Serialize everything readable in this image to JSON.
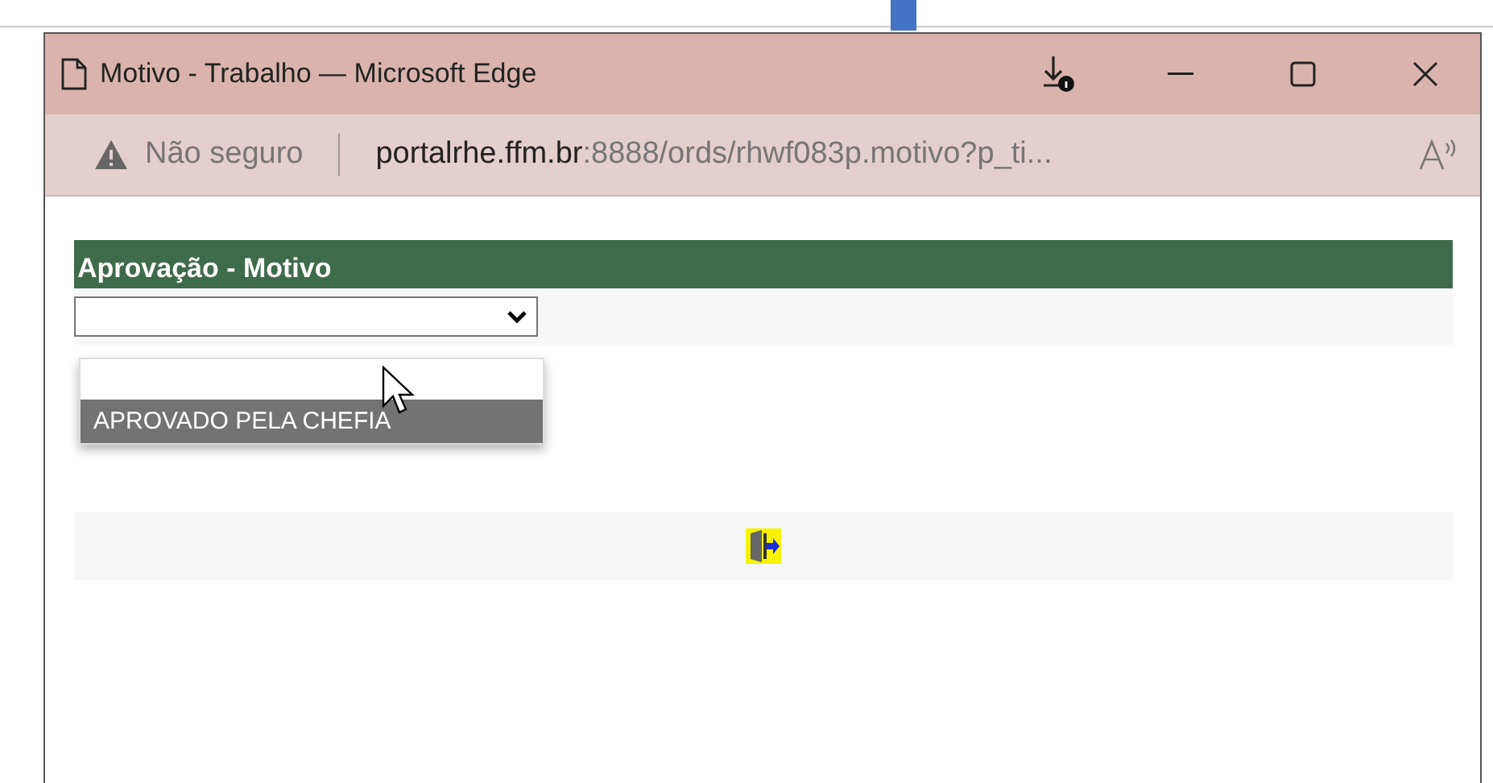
{
  "window": {
    "title": "Motivo - Trabalho — Microsoft Edge"
  },
  "address_bar": {
    "security": "Não seguro",
    "host": "portalrhe.ffm.br",
    "path": ":8888/ords/rhwf083p.motivo?p_ti..."
  },
  "form": {
    "header": "Aprovação - Motivo",
    "dropdown": {
      "expanded": true,
      "options": [
        {
          "label": "APROVADO PELA CHEFIA",
          "selected": true
        }
      ]
    }
  }
}
